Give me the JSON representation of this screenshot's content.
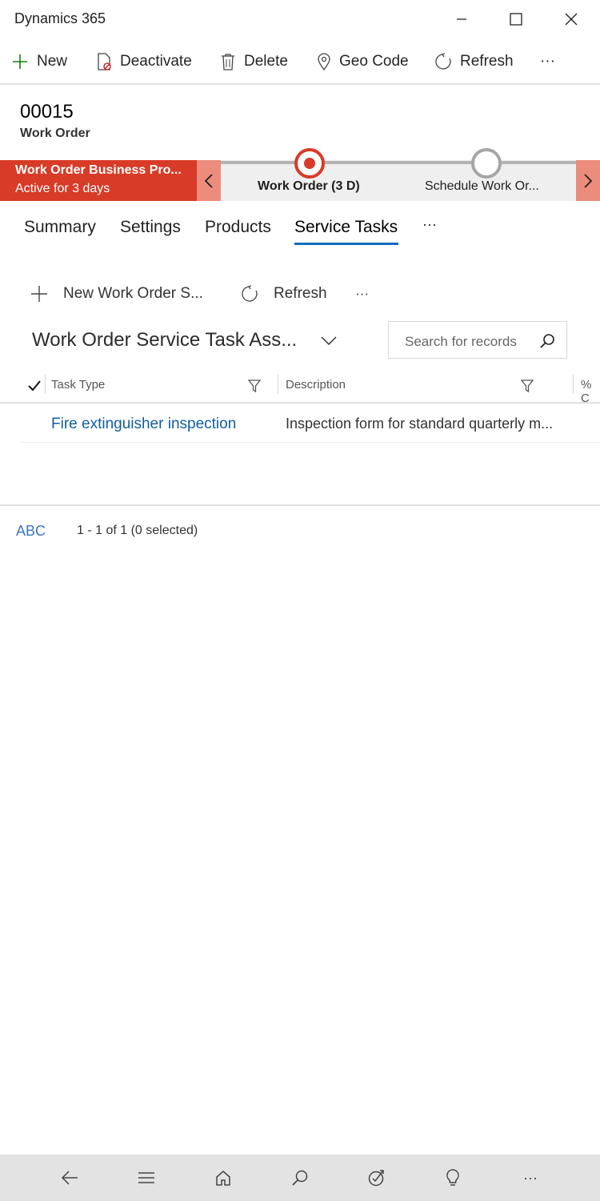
{
  "app": {
    "title": "Dynamics 365"
  },
  "commands": {
    "new": "New",
    "deactivate": "Deactivate",
    "delete": "Delete",
    "geo_code": "Geo Code",
    "refresh": "Refresh",
    "more": "···"
  },
  "record": {
    "id": "00015",
    "type": "Work Order"
  },
  "bpf": {
    "name": "Work Order Business Pro...",
    "active_for": "Active for 3 days",
    "stages": [
      {
        "label": "Work Order  (3 D)"
      },
      {
        "label": "Schedule Work Or..."
      }
    ],
    "accent_color": "#d83b27"
  },
  "tabs": [
    {
      "label": "Summary"
    },
    {
      "label": "Settings"
    },
    {
      "label": "Products"
    },
    {
      "label": "Service Tasks"
    },
    {
      "label": "···"
    }
  ],
  "subgrid": {
    "new_label": "New Work Order S...",
    "refresh_label": "Refresh",
    "more": "···",
    "view_title": "Work Order Service Task Ass...",
    "search_placeholder": "Search for records",
    "columns": [
      "Task Type",
      "Description",
      "% C"
    ],
    "rows": [
      {
        "task_type": "Fire extinguisher inspection",
        "description": "Inspection form for standard quarterly m..."
      }
    ],
    "footer_abc": "ABC",
    "footer_count": "1 - 1 of 1 (0 selected)"
  },
  "bottom_nav": {
    "icons": [
      "back-icon",
      "menu-icon",
      "home-icon",
      "search-icon",
      "activity-icon",
      "lightbulb-icon",
      "more-icon"
    ],
    "more": "···"
  }
}
